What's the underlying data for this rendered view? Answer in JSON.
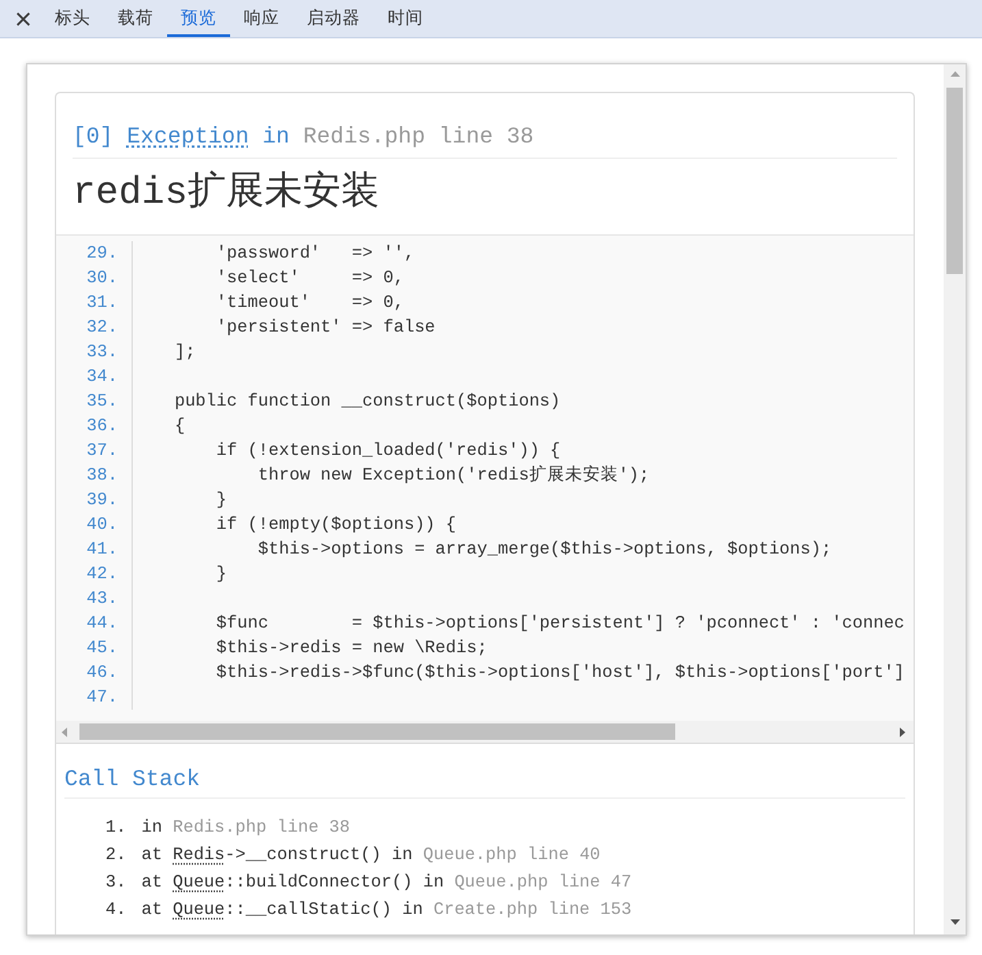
{
  "panel_tabs": [
    {
      "label": "标头",
      "selected": false
    },
    {
      "label": "载荷",
      "selected": false
    },
    {
      "label": "预览",
      "selected": true
    },
    {
      "label": "响应",
      "selected": false
    },
    {
      "label": "启动器",
      "selected": false
    },
    {
      "label": "时间",
      "selected": false
    }
  ],
  "exception": {
    "index": "[0]",
    "class_name": "Exception",
    "in": "in",
    "location": "Redis.php line 38",
    "message": "redis扩展未安装"
  },
  "source_code": {
    "lines": [
      {
        "number": "29.",
        "code": "        'password'   => '',"
      },
      {
        "number": "30.",
        "code": "        'select'     => 0,"
      },
      {
        "number": "31.",
        "code": "        'timeout'    => 0,"
      },
      {
        "number": "32.",
        "code": "        'persistent' => false"
      },
      {
        "number": "33.",
        "code": "    ];"
      },
      {
        "number": "34."
      },
      {
        "number": "35.",
        "code": "    public function __construct($options)"
      },
      {
        "number": "36.",
        "code": "    {"
      },
      {
        "number": "37.",
        "code": "        if (!extension_loaded('redis')) {"
      },
      {
        "number": "38.",
        "code": "            throw new Exception('redis扩展未安装');"
      },
      {
        "number": "39.",
        "code": "        }"
      },
      {
        "number": "40.",
        "code": "        if (!empty($options)) {"
      },
      {
        "number": "41.",
        "code": "            $this->options = array_merge($this->options, $options);"
      },
      {
        "number": "42.",
        "code": "        }"
      },
      {
        "number": "43."
      },
      {
        "number": "44.",
        "code": "        $func        = $this->options['persistent'] ? 'pconnect' : 'connec"
      },
      {
        "number": "45.",
        "code": "        $this->redis = new \\Redis;"
      },
      {
        "number": "46.",
        "code": "        $this->redis->$func($this->options['host'], $this->options['port']"
      },
      {
        "number": "47."
      }
    ]
  },
  "call_stack": {
    "title": "Call Stack",
    "frames": [
      {
        "number": "1.",
        "lead": "in",
        "location": "Redis.php line 38"
      },
      {
        "number": "2.",
        "lead": "at",
        "class_name": "Redis",
        "call": "->__construct() in",
        "location": "Queue.php line 40"
      },
      {
        "number": "3.",
        "lead": "at",
        "class_name": "Queue",
        "call": "::buildConnector() in",
        "location": "Queue.php line 47"
      },
      {
        "number": "4.",
        "lead": "at",
        "class_name": "Queue",
        "call": "::__callStatic() in",
        "location": "Create.php line 153"
      }
    ]
  }
}
